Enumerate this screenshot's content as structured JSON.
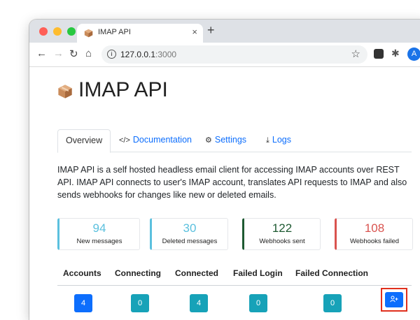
{
  "browser": {
    "tab_title": "IMAP API",
    "tab_close": "×",
    "new_tab": "+",
    "back": "←",
    "forward": "→",
    "reload": "↻",
    "home": "⌂",
    "url_host": "127.0.0.1",
    "url_port": ":3000",
    "bookmark_icon": "☆",
    "extensions_icon": "✱",
    "profile_initial": "A"
  },
  "page": {
    "title": "IMAP API",
    "tabs": [
      {
        "label": "Overview",
        "icon": ""
      },
      {
        "label": "Documentation",
        "icon": "code-icon"
      },
      {
        "label": "Settings",
        "icon": "gear-icon"
      },
      {
        "label": "Logs",
        "icon": "download-icon"
      }
    ],
    "description": "IMAP API is a self hosted headless email client for accessing IMAP accounts over REST API. IMAP API connects to user's IMAP account, translates API requests to IMAP and also sends webhooks for changes like new or deleted emails.",
    "stats": [
      {
        "value": "94",
        "label": "New messages",
        "color": "#5bc0de"
      },
      {
        "value": "30",
        "label": "Deleted messages",
        "color": "#5bc0de"
      },
      {
        "value": "122",
        "label": "Webhooks sent",
        "color": "#1e5a32"
      },
      {
        "value": "108",
        "label": "Webhooks failed",
        "color": "#d9534f"
      }
    ],
    "accounts_table": {
      "headers": [
        "Accounts",
        "Connecting",
        "Connected",
        "Failed Login",
        "Failed Connection"
      ],
      "values": [
        "4",
        "0",
        "4",
        "0",
        "0"
      ],
      "badge_colors": [
        "#0d6efd",
        "#17a2b8",
        "#17a2b8",
        "#17a2b8",
        "#17a2b8"
      ]
    },
    "add_account_icon": "user-plus-icon"
  }
}
